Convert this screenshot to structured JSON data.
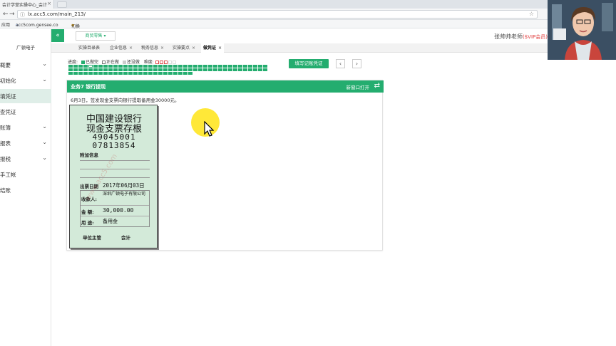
{
  "browser": {
    "tab_title": "会计学堂实操中心_会计",
    "tab_close": "×",
    "url": "lx.acc5.com/main_213/",
    "back": "←",
    "forward": "→",
    "bookmarks": [
      "应用",
      "acc5com.gensee.co",
      "切换"
    ]
  },
  "sidebar": {
    "company": "广顿电子",
    "items": [
      {
        "label": "概要",
        "expandable": true
      },
      {
        "label": "初始化",
        "expandable": true
      },
      {
        "label": "填凭证",
        "expandable": false,
        "active": true
      },
      {
        "label": "查凭证",
        "expandable": false
      },
      {
        "label": "账簿",
        "expandable": true
      },
      {
        "label": "报表",
        "expandable": true
      },
      {
        "label": "报税",
        "expandable": true
      },
      {
        "label": "手工帐",
        "expandable": false
      },
      {
        "label": "结账",
        "expandable": false
      }
    ]
  },
  "topbar": {
    "collapse": "«",
    "product": "商贸零售 ▾",
    "teacher": "张帅帅老师",
    "vip": "($VIP会员)"
  },
  "page_tabs": [
    {
      "label": "实操目录表",
      "closable": false
    },
    {
      "label": "企业信息",
      "closable": true
    },
    {
      "label": "税务信息",
      "closable": true
    },
    {
      "label": "实操要点",
      "closable": true
    },
    {
      "label": "做凭证",
      "closable": true,
      "active": true
    }
  ],
  "progress": {
    "label": "进度:",
    "legend": [
      "已做完",
      "正在做",
      "还没做"
    ],
    "difficulty_label": "难度:",
    "difficulty_level": 3,
    "difficulty_max": 5,
    "done_count": 45,
    "current_index": 4,
    "fill_button": "填写记账凭证",
    "prev": "‹",
    "next": "›"
  },
  "task": {
    "title": "业务7 银行提现",
    "new_window": "新窗口打开",
    "description": "6月3日，签发现金支票向银行提取备用金30000元。"
  },
  "cheque_stub": {
    "bank": "中国建设银行",
    "title": "现金支票存根",
    "number1": "49045001",
    "number2": "07813854",
    "extra_info_label": "附加信息",
    "date_label": "出票日期",
    "date_value": "2017年06月03日",
    "payee_label": "收款人:",
    "payee_value": "深圳广顿电子有限公司",
    "amount_label": "金 额:",
    "amount_value": "30,000.00",
    "purpose_label": "用 途:",
    "purpose_value": "备用金",
    "supervisor_label": "单位主管",
    "accountant_label": "会计",
    "watermark": "www.acc5.com"
  }
}
